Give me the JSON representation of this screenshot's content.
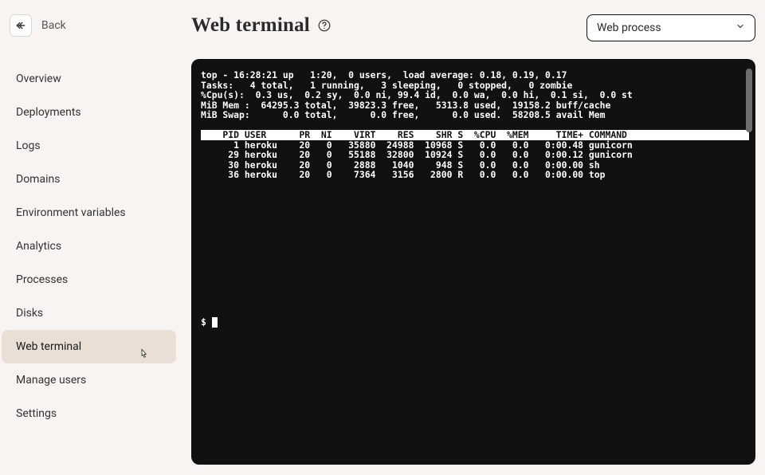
{
  "back": {
    "label": "Back"
  },
  "page": {
    "title": "Web terminal"
  },
  "dropdown": {
    "selected": "Web process"
  },
  "sidebar": {
    "items": [
      {
        "label": "Overview"
      },
      {
        "label": "Deployments"
      },
      {
        "label": "Logs"
      },
      {
        "label": "Domains"
      },
      {
        "label": "Environment variables"
      },
      {
        "label": "Analytics"
      },
      {
        "label": "Processes"
      },
      {
        "label": "Disks"
      },
      {
        "label": "Web terminal"
      },
      {
        "label": "Manage users"
      },
      {
        "label": "Settings"
      }
    ],
    "active_index": 8
  },
  "terminal": {
    "summary": {
      "line1": "top - 16:28:21 up   1:20,  0 users,  load average: 0.18, 0.19, 0.17",
      "line2": "Tasks:   4 total,   1 running,   3 sleeping,   0 stopped,   0 zombie",
      "line3": "%Cpu(s):  0.3 us,  0.2 sy,  0.0 ni, 99.4 id,  0.0 wa,  0.0 hi,  0.1 si,  0.0 st",
      "line4": "MiB Mem :  64295.3 total,  39823.3 free,   5313.8 used,  19158.2 buff/cache",
      "line5": "MiB Swap:      0.0 total,      0.0 free,      0.0 used.  58208.5 avail Mem"
    },
    "header": "    PID USER      PR  NI    VIRT    RES    SHR S  %CPU  %MEM     TIME+ COMMAND   ",
    "rows": [
      "      1 heroku    20   0   35880  24988  10968 S   0.0   0.0   0:00.48 gunicorn",
      "     29 heroku    20   0   55188  32800  10924 S   0.0   0.0   0:00.12 gunicorn",
      "     30 heroku    20   0    2888   1040    948 S   0.0   0.0   0:00.00 sh",
      "     36 heroku    20   0    7364   3156   2800 R   0.0   0.0   0:00.00 top"
    ],
    "prompt": "$ "
  }
}
